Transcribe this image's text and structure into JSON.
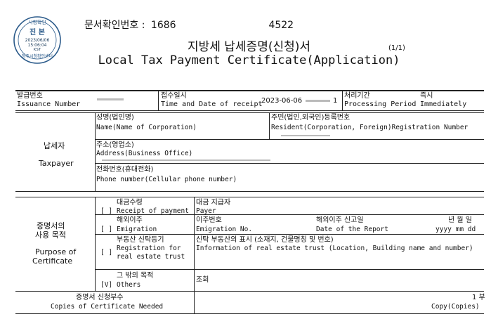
{
  "seal": {
    "top_text": "시청확인",
    "center_label": "진 본",
    "date": "2023/06/06",
    "time": "15:06:04",
    "tz": "KST",
    "bottom_text": "청주시청확인센터"
  },
  "header": {
    "confirm_label": "문서확인번호 :",
    "confirm_number_1": "1686",
    "confirm_number_2": "4522",
    "title_ko": "지방세 납세증명(신청)서",
    "title_en": "Local Tax Payment Certificate(Application)",
    "page": "(1/1)"
  },
  "row1": {
    "issuance_ko": "발급번호",
    "issuance_en": "Issuance Number",
    "receipt_ko": "접수일시",
    "receipt_en": "Time and Date of receipt",
    "receipt_value": "2023-06-06",
    "receipt_value_2": "1",
    "period_ko": "처리기간",
    "period_en": "Processing Period",
    "period_value_ko": "즉시",
    "period_value_en": "Immediately"
  },
  "taxpayer": {
    "label_ko": "납세자",
    "label_en": "Taxpayer",
    "name_ko": "성명(법인명)",
    "name_en": "Name(Name of Corporation)",
    "resident_ko": "주민(법인,외국인)등록번호",
    "resident_en": "Resident(Corporation, Foreign)Registration Number",
    "address_ko": "주소(영업소)",
    "address_en": "Address(Business Office)",
    "phone_ko": "전화번호(휴대전화)",
    "phone_en": "Phone number(Cellular phone number)"
  },
  "purpose": {
    "label_ko_1": "증명서의",
    "label_ko_2": "사용 목적",
    "label_en_1": "Purpose of",
    "label_en_2": "Certificate",
    "rows": [
      {
        "check": "[ ]",
        "item_ko": "대금수령",
        "item_en": "Receipt of payment",
        "info_ko": "대금 지급자",
        "info_en": "Payer"
      },
      {
        "check": "[ ]",
        "item_ko": "해외이주",
        "item_en": "Emigration",
        "info_ko": "이주번호",
        "info_en": "Emigration No."
      },
      {
        "check": "[ ]",
        "item_ko": "부동산 신탁등기",
        "item_en_1": "Registration for",
        "item_en_2": "real estate trust",
        "info_ko": "신탁 부동산의 표시 (소재지, 건물명칭 및 번호)",
        "info_en": "Information of real estate trust (Location, Building name and number)"
      },
      {
        "check": "[V]",
        "item_ko": "그 밖의 목적",
        "item_en": "Others",
        "info_ko": "조회"
      }
    ],
    "report_ko": "해외이주 신고일",
    "report_en": "Date of the Report",
    "date_ko": "년 월 일",
    "date_en": "yyyy  mm  dd"
  },
  "copies": {
    "label_ko": "증명서 신청부수",
    "label_en": "Copies of Certificate Needed",
    "value_ko": "1 부",
    "value_en": "Copy(Copies)"
  }
}
